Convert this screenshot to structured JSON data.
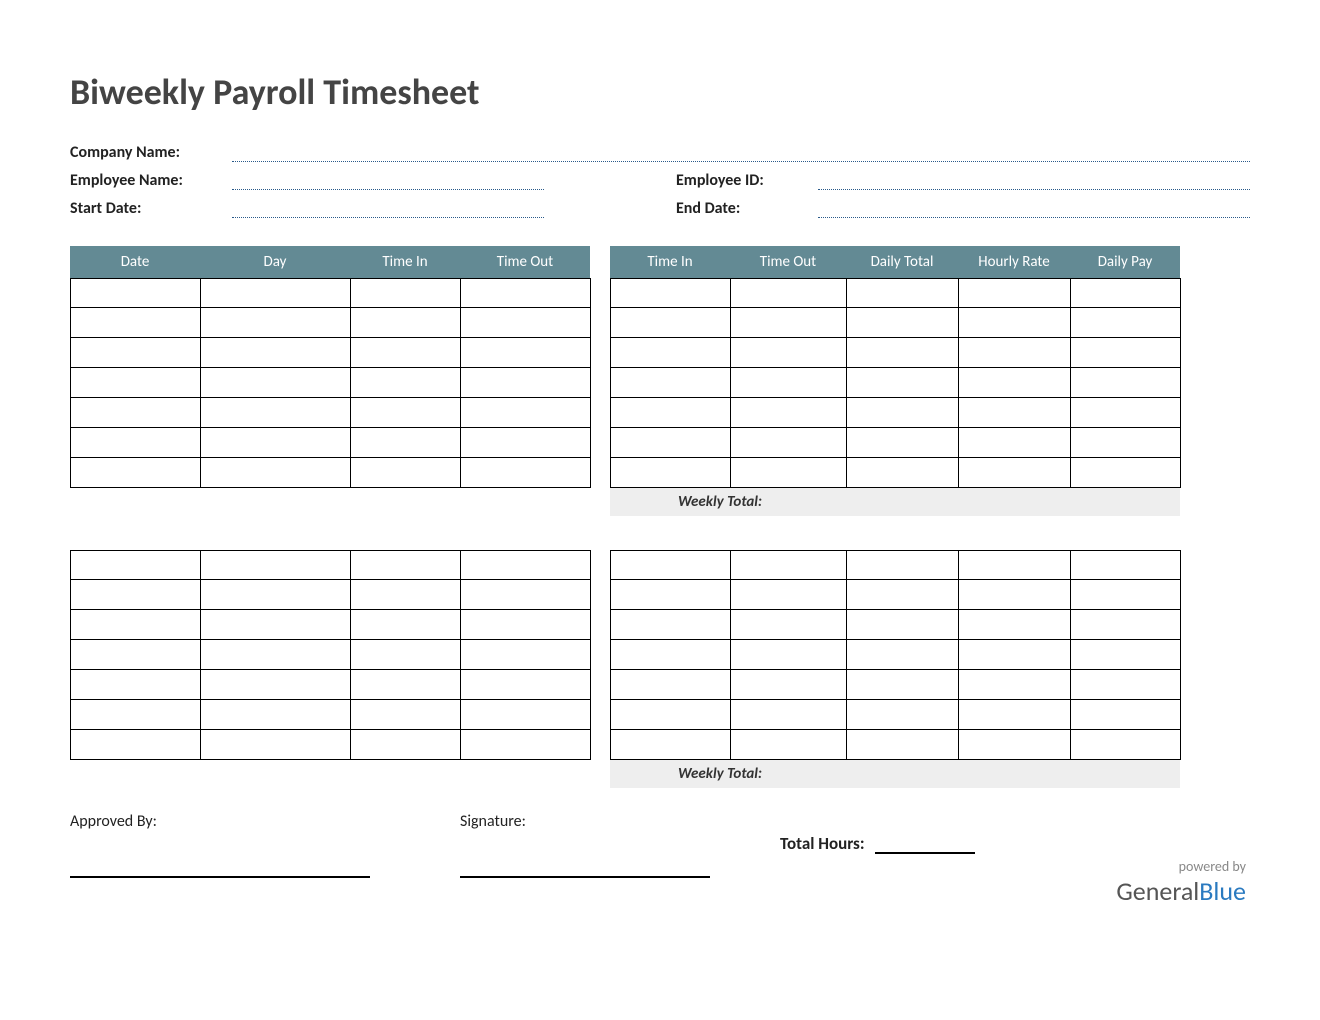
{
  "title": "Biweekly Payroll Timesheet",
  "meta": {
    "company_label": "Company Name:",
    "employee_label": "Employee Name:",
    "employee_id_label": "Employee ID:",
    "start_date_label": "Start Date:",
    "end_date_label": "End Date:"
  },
  "columns": {
    "date": "Date",
    "day": "Day",
    "time_in_1": "Time In",
    "time_out_1": "Time Out",
    "time_in_2": "Time In",
    "time_out_2": "Time Out",
    "daily_total": "Daily Total",
    "hourly_rate": "Hourly Rate",
    "daily_pay": "Daily Pay"
  },
  "weekly_total_label_1": "Weekly Total:",
  "weekly_total_label_2": "Weekly Total:",
  "footer": {
    "approved_by": "Approved By:",
    "signature": "Signature:",
    "total_hours": "Total Hours:"
  },
  "branding": {
    "powered_by": "powered by",
    "brand_a": "General",
    "brand_b": "Blue"
  }
}
